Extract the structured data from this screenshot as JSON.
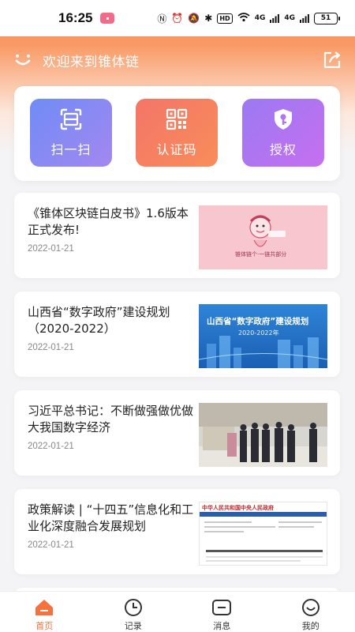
{
  "status_bar": {
    "time": "16:25",
    "battery": "51",
    "network1": "4G",
    "network2": "4G",
    "hd": "HD"
  },
  "header": {
    "greeting": "欢迎来到锥体链"
  },
  "actions": [
    {
      "label": "扫一扫",
      "icon": "scan-icon"
    },
    {
      "label": "认证码",
      "icon": "qrcode-icon"
    },
    {
      "label": "授权",
      "icon": "shield-key-icon"
    }
  ],
  "news": [
    {
      "title": "《锥体区块链白皮书》1.6版本正式发布!",
      "date": "2022-01-21",
      "thumb_caption": "锥体链个·一链共部分"
    },
    {
      "title": "山西省“数字政府”建设规划（2020-2022）",
      "date": "2022-01-21",
      "thumb_title": "山西省“数字政府”建设规划",
      "thumb_sub": "2020-2022年"
    },
    {
      "title": "习近平总书记：不断做强做优做大我国数字经济",
      "date": "2022-01-21"
    },
    {
      "title": "政策解读 | “十四五”信息化和工业化深度融合发展规划",
      "date": "2022-01-21",
      "thumb_header": "中华人民共和国中央人民政府"
    }
  ],
  "tabs": [
    {
      "label": "首页",
      "active": true
    },
    {
      "label": "记录",
      "active": false
    },
    {
      "label": "消息",
      "active": false
    },
    {
      "label": "我的",
      "active": false
    }
  ],
  "colors": {
    "accent": "#f5713d",
    "scan": "#7b8af3",
    "cert": "#f57d62",
    "auth": "#b075f1"
  }
}
